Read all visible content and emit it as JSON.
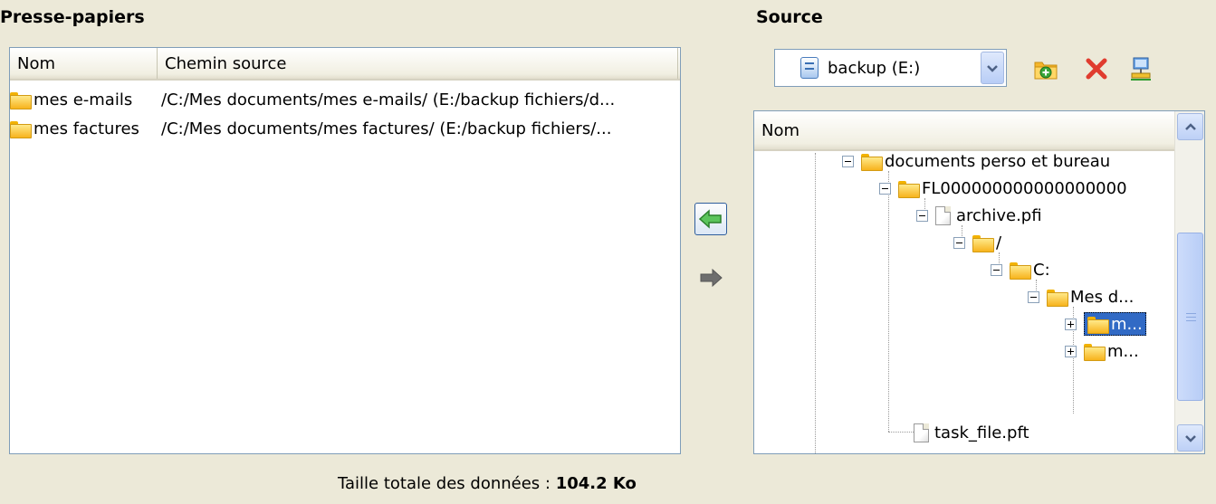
{
  "clipboard": {
    "title": "Presse-papiers",
    "columns": [
      "Nom",
      "Chemin source"
    ],
    "rows": [
      {
        "name": "mes e-mails",
        "path": "/C:/Mes documents/mes e-mails/ (E:/backup fichiers/d..."
      },
      {
        "name": "mes factures",
        "path": "/C:/Mes documents/mes factures/ (E:/backup fichiers/..."
      }
    ],
    "total_label": "Taille totale des données : ",
    "total_value": "104.2 Ko"
  },
  "transfer": {
    "left_icon": "arrow-left-icon",
    "right_icon": "arrow-right-icon"
  },
  "source": {
    "title": "Source",
    "drive_label": "backup (E:)",
    "toolbar_icons": [
      "add-folder-icon",
      "delete-icon",
      "network-icon"
    ],
    "tree_header": "Nom",
    "tree": [
      {
        "label": "documents perso et bureau",
        "type": "folder",
        "expander": "minus"
      },
      {
        "label": "FL000000000000000000",
        "type": "folder",
        "expander": "minus"
      },
      {
        "label": "archive.pfi",
        "type": "file",
        "expander": "minus"
      },
      {
        "label": "/",
        "type": "folder",
        "expander": "minus"
      },
      {
        "label": "C:",
        "type": "folder",
        "expander": "minus"
      },
      {
        "label": "Mes d...",
        "type": "folder",
        "expander": "minus"
      },
      {
        "label": "m...",
        "type": "folder",
        "expander": "plus",
        "selected": true
      },
      {
        "label": "m...",
        "type": "folder",
        "expander": "plus"
      },
      {
        "label": "task_file.pft",
        "type": "file",
        "expander": "none"
      }
    ]
  },
  "colors": {
    "background": "#ece9d8",
    "selection": "#316ac5",
    "arrow_green": "#3aa63a",
    "delete_red": "#e03c2f"
  }
}
